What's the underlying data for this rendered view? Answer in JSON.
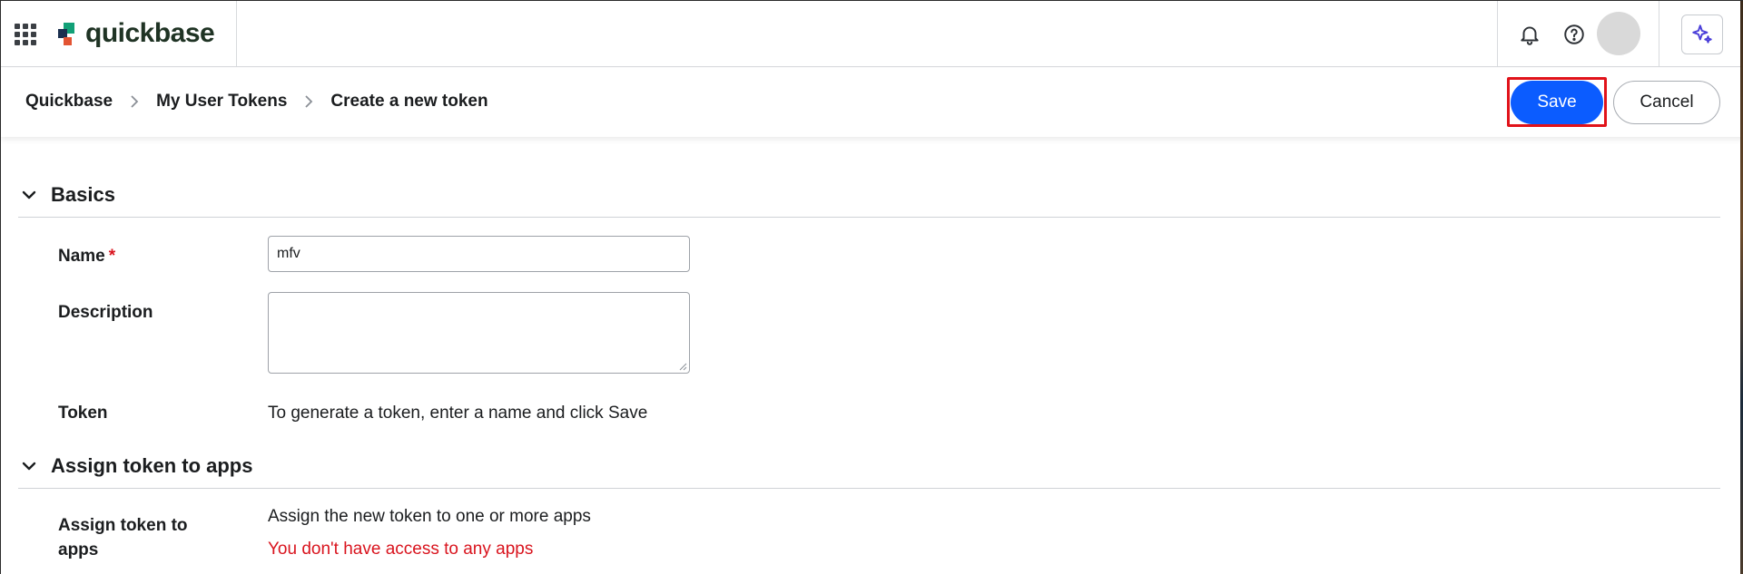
{
  "topbar": {
    "logo_text": "quickbase",
    "icons": {
      "apps": "grid-icon",
      "notifications": "bell-icon",
      "help": "help-circle-icon",
      "ai": "sparkle-icon"
    }
  },
  "header": {
    "breadcrumb": [
      "Quickbase",
      "My User Tokens",
      "Create a new token"
    ],
    "save_label": "Save",
    "cancel_label": "Cancel"
  },
  "basics": {
    "title": "Basics",
    "name_label": "Name",
    "required_marker": "*",
    "name_value": "mfv",
    "description_label": "Description",
    "description_value": "",
    "token_label": "Token",
    "token_hint": "To generate a token, enter a name and click Save"
  },
  "assign": {
    "title": "Assign token to apps",
    "label": "Assign token to apps",
    "hint": "Assign the new token to one or more apps",
    "error": "You don't have access to any apps"
  },
  "colors": {
    "primary": "#0b5cff",
    "error": "#d9141e",
    "highlight": "#e1131a",
    "logo_text": "#1f3324"
  }
}
